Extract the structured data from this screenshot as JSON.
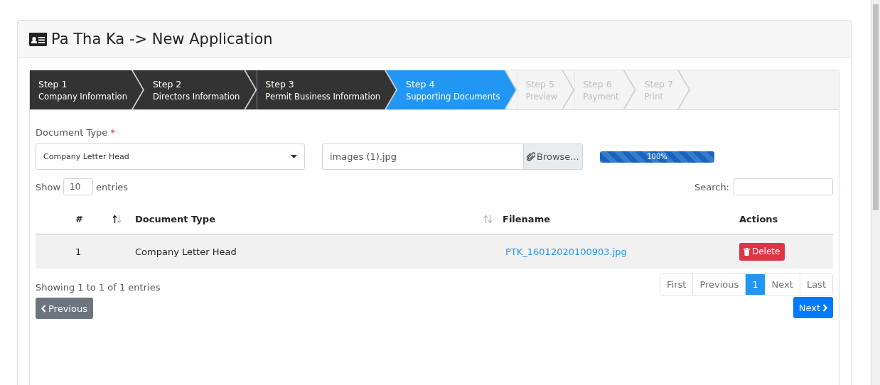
{
  "page": {
    "title": "Pa Tha Ka -> New Application"
  },
  "steps": [
    {
      "number": "Step 1",
      "label": "Company Information",
      "completed": true,
      "selected": false
    },
    {
      "number": "Step 2",
      "label": "Directors Information",
      "completed": true,
      "selected": false
    },
    {
      "number": "Step 3",
      "label": "Permit Business Information",
      "completed": true,
      "selected": false
    },
    {
      "number": "Step 4",
      "label": "Supporting Documents",
      "completed": false,
      "selected": true
    },
    {
      "number": "Step 5",
      "label": "Preview",
      "completed": false,
      "selected": false
    },
    {
      "number": "Step 6",
      "label": "Payment",
      "completed": false,
      "selected": false
    },
    {
      "number": "Step 7",
      "label": "Print",
      "completed": false,
      "selected": false
    }
  ],
  "form": {
    "label": "Document Type",
    "required_mark": "*",
    "select_value": "Company Letter Head",
    "file_value": "images (1).jpg",
    "browse_label": "Browse...",
    "progress": {
      "level": 1,
      "reading": "100%"
    }
  },
  "table_controls": {
    "show_label": "Show",
    "page_size": "10",
    "entries_label": "entries",
    "search_label": "Search:"
  },
  "table": {
    "columns": [
      {
        "label": "#",
        "sorted": true
      },
      {
        "label": "Document Type",
        "sorted": false
      },
      {
        "label": "Filename"
      },
      {
        "label": "Actions"
      }
    ],
    "rows": [
      {
        "number": "1",
        "document_type": "Company Letter Head",
        "filename": "PTK_16012020100903.jpg",
        "action": "Delete"
      }
    ]
  },
  "info": "Showing 1 to 1 of 1 entries",
  "pagination": [
    {
      "label": "First",
      "selected": false
    },
    {
      "label": "Previous",
      "selected": false
    },
    {
      "label": "1",
      "selected": true
    },
    {
      "label": "Next",
      "selected": false
    },
    {
      "label": "Last",
      "selected": false
    }
  ],
  "nav": {
    "previous": "Previous",
    "next": "Next"
  }
}
